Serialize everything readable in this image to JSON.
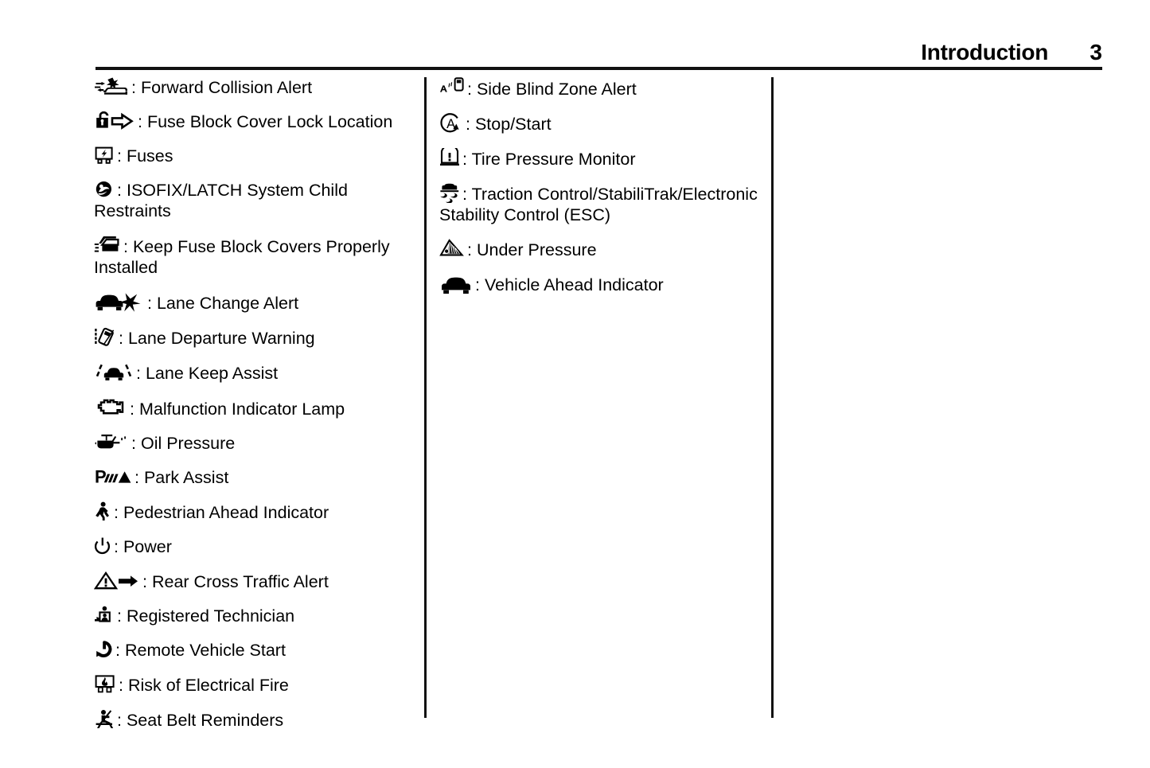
{
  "header": {
    "title": "Introduction",
    "page_number": "3"
  },
  "separator": ":",
  "columns": {
    "left": [
      {
        "icon": "forward-collision-alert-icon",
        "label": "Forward Collision Alert"
      },
      {
        "icon": "fuse-block-cover-lock-location-icon",
        "label": "Fuse Block Cover Lock Location"
      },
      {
        "icon": "fuses-icon",
        "label": "Fuses"
      },
      {
        "icon": "isofix-latch-child-restraint-icon",
        "label": "ISOFIX/LATCH System Child Restraints"
      },
      {
        "icon": "keep-fuse-block-covers-installed-icon",
        "label": "Keep Fuse Block Covers Properly Installed"
      },
      {
        "icon": "lane-change-alert-icon",
        "label": "Lane Change Alert"
      },
      {
        "icon": "lane-departure-warning-icon",
        "label": "Lane Departure Warning"
      },
      {
        "icon": "lane-keep-assist-icon",
        "label": "Lane Keep Assist"
      },
      {
        "icon": "malfunction-indicator-lamp-icon",
        "label": "Malfunction Indicator Lamp"
      },
      {
        "icon": "oil-pressure-icon",
        "label": "Oil Pressure"
      },
      {
        "icon": "park-assist-icon",
        "label": "Park Assist"
      },
      {
        "icon": "pedestrian-ahead-indicator-icon",
        "label": "Pedestrian Ahead Indicator"
      },
      {
        "icon": "power-icon",
        "label": "Power"
      },
      {
        "icon": "rear-cross-traffic-alert-icon",
        "label": "Rear Cross Traffic Alert"
      },
      {
        "icon": "registered-technician-icon",
        "label": "Registered Technician"
      },
      {
        "icon": "remote-vehicle-start-icon",
        "label": "Remote Vehicle Start"
      },
      {
        "icon": "risk-of-electrical-fire-icon",
        "label": "Risk of Electrical Fire"
      },
      {
        "icon": "seat-belt-reminders-icon",
        "label": "Seat Belt Reminders"
      }
    ],
    "middle": [
      {
        "icon": "side-blind-zone-alert-icon",
        "label": "Side Blind Zone Alert"
      },
      {
        "icon": "stop-start-icon",
        "label": "Stop/Start"
      },
      {
        "icon": "tire-pressure-monitor-icon",
        "label": "Tire Pressure Monitor"
      },
      {
        "icon": "traction-control-icon",
        "label": "Traction Control/StabiliTrak/Electronic Stability Control (ESC)"
      },
      {
        "icon": "under-pressure-icon",
        "label": "Under Pressure"
      },
      {
        "icon": "vehicle-ahead-indicator-icon",
        "label": "Vehicle Ahead Indicator"
      }
    ],
    "right": []
  },
  "colors": {
    "ink": "#000000",
    "rule": "#111111",
    "paper": "#ffffff"
  }
}
